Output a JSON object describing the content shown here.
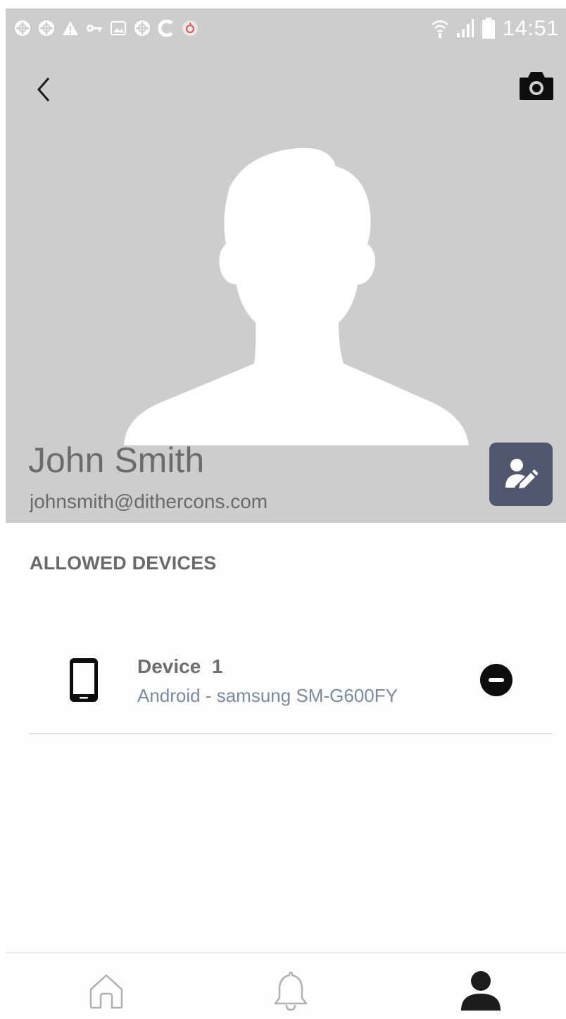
{
  "status_bar": {
    "time": "14:51",
    "left_icons": [
      "grid-circle-icon",
      "grid-circle-icon",
      "warning-icon",
      "key-icon",
      "image-icon",
      "grid-circle-icon",
      "c-app-icon",
      "red-app-icon"
    ],
    "right_icons": [
      "wifi-icon",
      "signal-icon",
      "battery-icon"
    ]
  },
  "header": {
    "back_icon": "chevron-left-icon",
    "camera_icon": "camera-icon",
    "background_color": "#cdcdcd"
  },
  "profile": {
    "name": "John Smith",
    "email": "johnsmith@dithercons.com",
    "edit_icon": "user-edit-icon",
    "edit_button_color": "#4f566e"
  },
  "devices_section": {
    "title": "ALLOWED DEVICES",
    "items": [
      {
        "name": "Device  1",
        "detail": "Android - samsung SM-G600FY",
        "icon": "smartphone-icon",
        "action_icon": "remove-circle-icon"
      }
    ]
  },
  "bottom_nav": {
    "items": [
      {
        "icon": "home-icon",
        "active": false
      },
      {
        "icon": "bell-icon",
        "active": false
      },
      {
        "icon": "user-icon",
        "active": true
      }
    ]
  },
  "colors": {
    "muted_text": "#6a6a6a",
    "device_detail": "#7a8aa3",
    "active_nav": "#1c1c1c",
    "inactive_nav": "#b0b0b0"
  }
}
